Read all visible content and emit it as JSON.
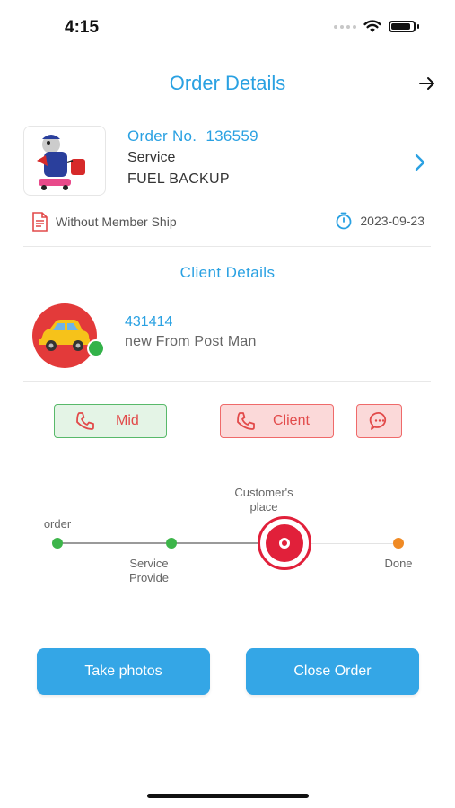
{
  "status_bar": {
    "time": "4:15"
  },
  "header": {
    "title": "Order Details",
    "action_icon": "arrow-right-icon"
  },
  "order": {
    "number_label": "Order No.",
    "number": "136559",
    "service_label": "Service",
    "service_name": "FUEL BACKUP",
    "membership": "Without Member Ship",
    "date": "2023-09-23"
  },
  "client_section": {
    "title": "Client Details",
    "client_id": "431414",
    "client_name": "new From Post Man"
  },
  "actions": {
    "mid_label": "Mid",
    "client_label": "Client",
    "chat_icon": "chat-icon"
  },
  "progress": {
    "steps": [
      {
        "label": "order",
        "state": "done"
      },
      {
        "label": "Service Provide",
        "state": "done"
      },
      {
        "label": "Customer's place",
        "state": "current"
      },
      {
        "label": "Done",
        "state": "pending"
      }
    ]
  },
  "buttons": {
    "take_photos": "Take photos",
    "close_order": "Close Order"
  },
  "colors": {
    "accent": "#2aa1e2",
    "primary_button": "#34a6e6",
    "danger": "#e1203a",
    "success": "#3db54a",
    "pending": "#f08a24"
  }
}
